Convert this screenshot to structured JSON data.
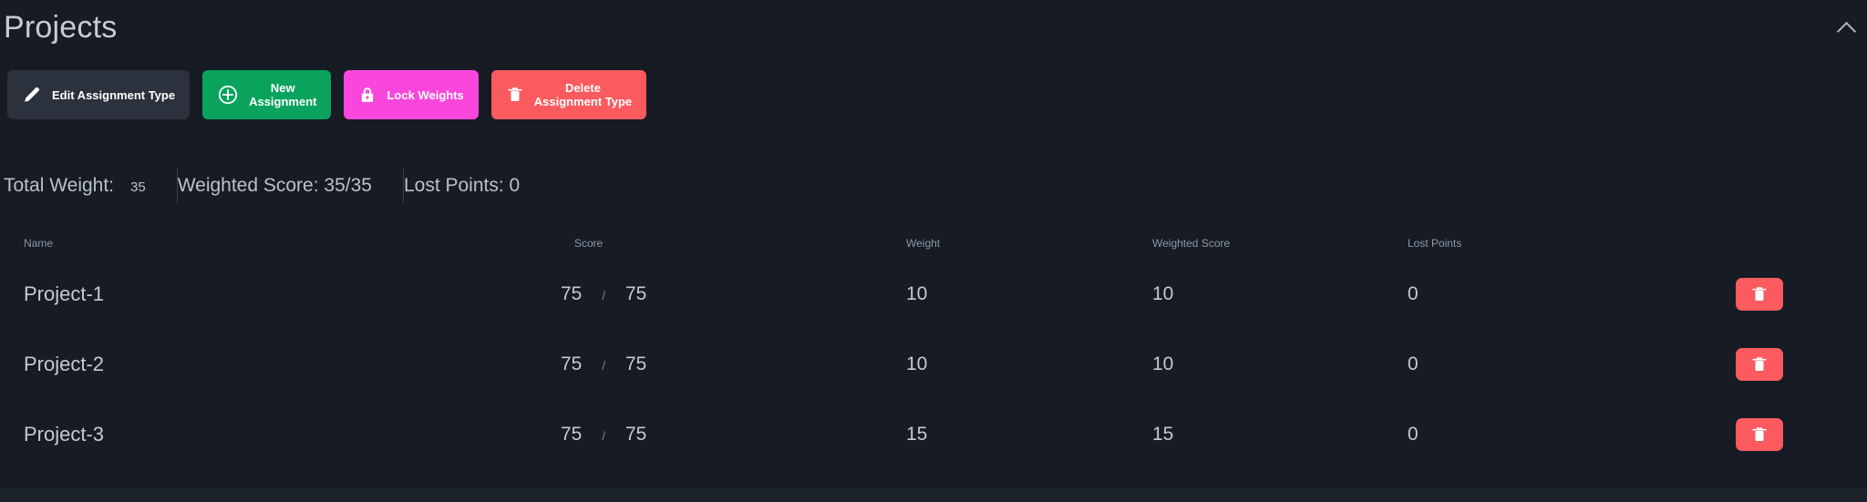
{
  "header": {
    "title": "Projects",
    "collapse_icon": "chevron-up-icon"
  },
  "toolbar": {
    "buttons": [
      {
        "label": "Edit Assignment Type",
        "icon": "pencil-icon",
        "color": "#2b313d"
      },
      {
        "label": "New\nAssignment",
        "icon": "plus-circle-icon",
        "color": "#0aa35e"
      },
      {
        "label": "Lock Weights",
        "icon": "lock-icon",
        "color": "#fa46dc"
      },
      {
        "label": "Delete\nAssignment Type",
        "icon": "trash-icon",
        "color": "#fb5a5f"
      }
    ]
  },
  "stats": {
    "total_weight_label": "Total Weight:",
    "total_weight_value": "35",
    "weighted_score": "Weighted Score: 35/35",
    "lost_points": "Lost Points: 0"
  },
  "table": {
    "columns": {
      "name": "Name",
      "score": "Score",
      "weight": "Weight",
      "weighted_score": "Weighted Score",
      "lost_points": "Lost Points"
    },
    "score_separator": "/",
    "row_delete_icon": "trash-icon",
    "rows": [
      {
        "name": "Project-1",
        "score": "75",
        "score_max": "75",
        "weight": "10",
        "weighted_score": "10",
        "lost_points": "0"
      },
      {
        "name": "Project-2",
        "score": "75",
        "score_max": "75",
        "weight": "10",
        "weighted_score": "10",
        "lost_points": "0"
      },
      {
        "name": "Project-3",
        "score": "75",
        "score_max": "75",
        "weight": "15",
        "weighted_score": "15",
        "lost_points": "0"
      }
    ]
  },
  "theme": {
    "background": "#161b24",
    "panel_bottom": "#1d232d",
    "text": "#c3cad6",
    "muted_text": "#8d97a8",
    "green": "#0aa35e",
    "magenta": "#fa46dc",
    "red": "#fb5a5f",
    "slate": "#2b313d"
  }
}
